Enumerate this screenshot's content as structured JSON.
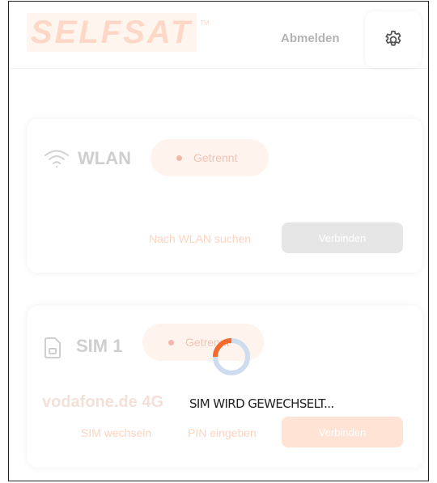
{
  "header": {
    "logo_text": "SELFSAT",
    "logo_tm": "TM",
    "logout_label": "Abmelden",
    "settings_icon": "gear-icon"
  },
  "wlan": {
    "title": "WLAN",
    "icon": "wifi-icon",
    "status": "Getrennt",
    "search_label": "Nach WLAN suchen",
    "connect_label": "Verbinden"
  },
  "sim": {
    "title": "SIM 1",
    "icon": "sim-card-icon",
    "status": "Getrennt",
    "operator": "vodafone.de 4G",
    "switch_label": "SIM wechseln",
    "pin_label": "PIN eingeben",
    "connect_label": "Verbinden"
  },
  "overlay": {
    "message": "SIM WIRD GEWECHSELT...",
    "spinner_color": "#f26a2e",
    "spinner_track_color": "#cddcef"
  }
}
